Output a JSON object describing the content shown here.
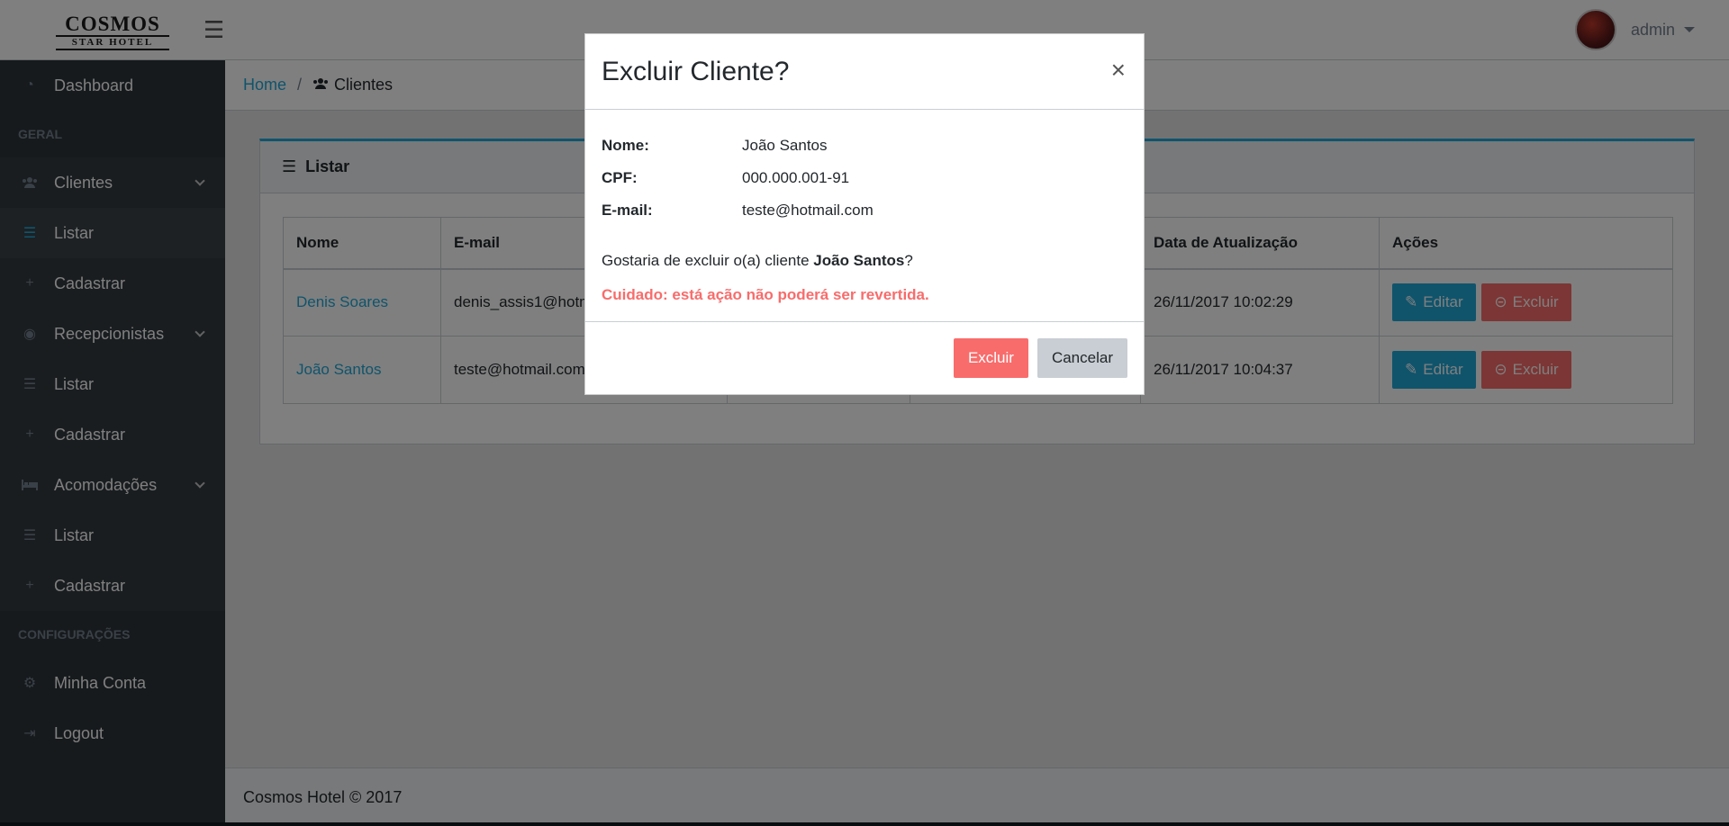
{
  "brand": {
    "line1": "COSMOS",
    "line2": "STAR HOTEL"
  },
  "user": {
    "name": "admin"
  },
  "sidebar": {
    "dashboard": "Dashboard",
    "section_geral": "GERAL",
    "clientes": "Clientes",
    "clientes_listar": "Listar",
    "clientes_cadastrar": "Cadastrar",
    "recepcionistas": "Recepcionistas",
    "recepcionistas_listar": "Listar",
    "recepcionistas_cadastrar": "Cadastrar",
    "acomodacoes": "Acomodações",
    "acomodacoes_listar": "Listar",
    "acomodacoes_cadastrar": "Cadastrar",
    "section_config": "CONFIGURAÇÕES",
    "minha_conta": "Minha Conta",
    "logout": "Logout"
  },
  "breadcrumb": {
    "home": "Home",
    "separator": "/",
    "current": "Clientes"
  },
  "card": {
    "title": "Listar"
  },
  "table": {
    "headers": [
      "Nome",
      "E-mail",
      "",
      "",
      "Data de Atualização",
      "Ações"
    ],
    "rows": [
      {
        "nome": "Denis Soares",
        "email": "denis_assis1@hotm",
        "updated": "26/11/2017 10:02:29"
      },
      {
        "nome": "João Santos",
        "email": "teste@hotmail.com",
        "updated": "26/11/2017 10:04:37"
      }
    ],
    "edit_label": "Editar",
    "delete_label": "Excluir"
  },
  "footer": {
    "text": "Cosmos Hotel © 2017"
  },
  "modal": {
    "title": "Excluir Cliente?",
    "close": "×",
    "fields": [
      {
        "label": "Nome:",
        "value": "João Santos"
      },
      {
        "label": "CPF:",
        "value": "000.000.001-91"
      },
      {
        "label": "E-mail:",
        "value": "teste@hotmail.com"
      }
    ],
    "question_prefix": "Gostaria de excluir o(a) cliente ",
    "question_name": "João Santos",
    "question_suffix": "?",
    "warning": "Cuidado: está ação não poderá ser revertida.",
    "confirm_label": "Excluir",
    "cancel_label": "Cancelar"
  }
}
